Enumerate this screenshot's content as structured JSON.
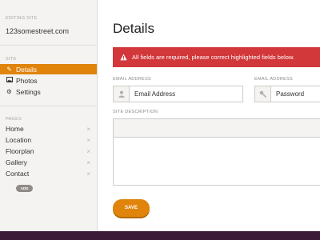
{
  "sidebar": {
    "editing_label": "EDITING SITE",
    "site_name": "123somestreet.com",
    "site_section_label": "SITE",
    "nav": [
      {
        "label": "Details",
        "icon": "pencil-icon",
        "active": true
      },
      {
        "label": "Photos",
        "icon": "image-icon",
        "active": false
      },
      {
        "label": "Settings",
        "icon": "gear-icon",
        "active": false
      }
    ],
    "pages_section_label": "PAGES",
    "pages": [
      {
        "label": "Home"
      },
      {
        "label": "Location"
      },
      {
        "label": "Floorplan"
      },
      {
        "label": "Gallery"
      },
      {
        "label": "Contact"
      }
    ],
    "remove_glyph": "×",
    "add_label": "ADD"
  },
  "main": {
    "title": "Details",
    "alert": {
      "text": "All fields are required, please correct highlighted fields below.",
      "icon": "warning-icon",
      "color": "#d2373a"
    },
    "email_field": {
      "label": "EMAIL ADDRESS",
      "value": "Email Address",
      "icon": "person-icon"
    },
    "password_field": {
      "label": "EMAIL ADDRESS",
      "value": "Password",
      "icon": "key-icon"
    },
    "description_label": "SITE DESCRIPTION",
    "save_label": "SAVE"
  },
  "colors": {
    "accent": "#e0840c",
    "frame": "#3b1a38",
    "sidebar_bg": "#f4f3f1"
  }
}
